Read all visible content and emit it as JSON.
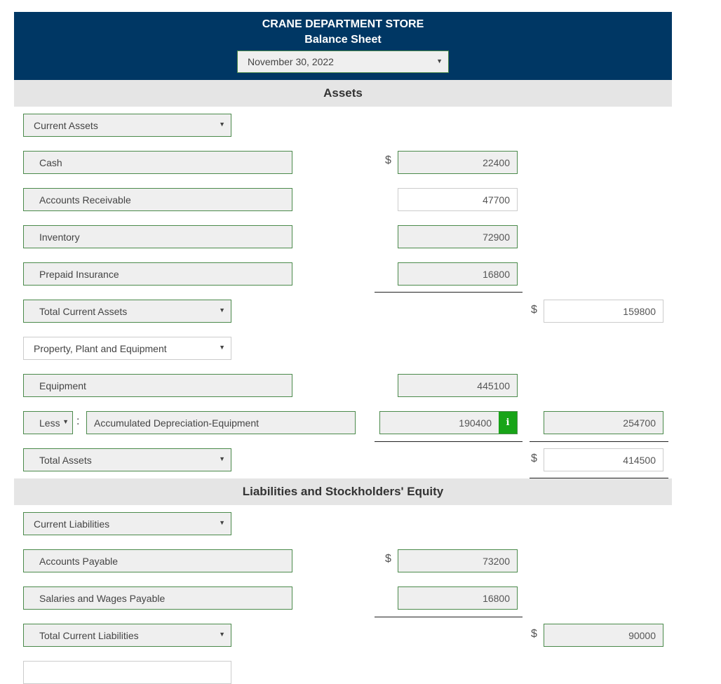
{
  "header": {
    "company": "CRANE DEPARTMENT STORE",
    "statement": "Balance Sheet",
    "date_select": "November 30, 2022"
  },
  "assets_section": {
    "title": "Assets",
    "current_assets_select": "Current Assets",
    "items": [
      {
        "label": "Cash",
        "amount": "22400",
        "currency": "$"
      },
      {
        "label": "Accounts Receivable",
        "amount": "47700"
      },
      {
        "label": "Inventory",
        "amount": "72900"
      },
      {
        "label": "Prepaid Insurance",
        "amount": "16800"
      }
    ],
    "total_current_assets": {
      "label": "Total Current Assets",
      "amount": "159800",
      "currency": "$"
    },
    "ppe_select": "Property, Plant and Equipment",
    "equipment": {
      "label": "Equipment",
      "amount": "445100"
    },
    "accum_dep": {
      "operator": "Less",
      "label": "Accumulated Depreciation-Equipment",
      "amount": "190400",
      "net": "254700"
    },
    "total_assets": {
      "label": "Total Assets",
      "amount": "414500",
      "currency": "$"
    }
  },
  "liabilities_section": {
    "title": "Liabilities and Stockholders' Equity",
    "current_liabilities_select": "Current Liabilities",
    "items": [
      {
        "label": "Accounts Payable",
        "amount": "73200",
        "currency": "$"
      },
      {
        "label": "Salaries and Wages Payable",
        "amount": "16800"
      }
    ],
    "total_current_liabilities": {
      "label": "Total Current Liabilities",
      "amount": "90000",
      "currency": "$"
    }
  },
  "icons": {
    "caret": "▼",
    "info": "i",
    "colon": ":"
  }
}
